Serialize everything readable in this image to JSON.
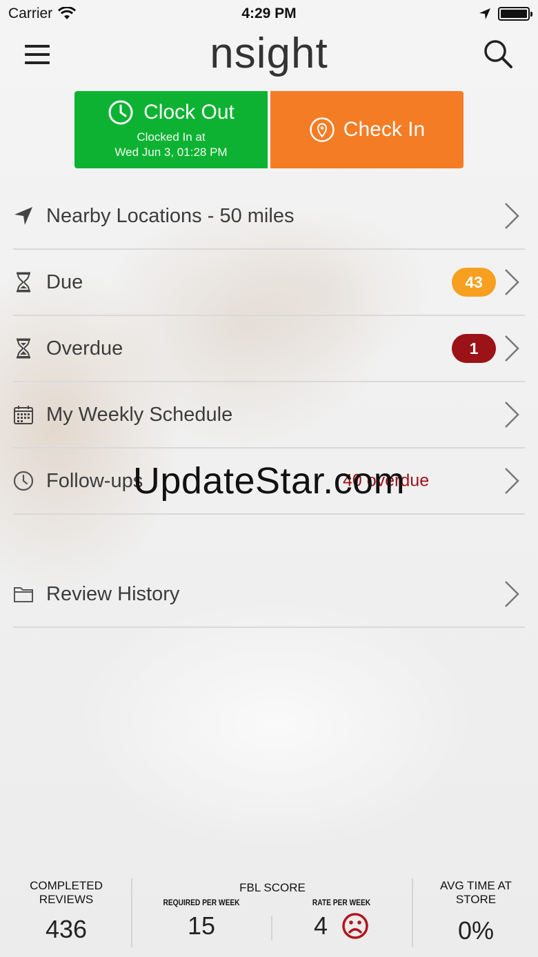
{
  "status_bar": {
    "carrier": "Carrier",
    "time": "4:29 PM"
  },
  "nav": {
    "brand": "nsight"
  },
  "actions": {
    "clock_out": {
      "label": "Clock Out",
      "sub_line1": "Clocked In at",
      "sub_line2": "Wed Jun 3, 01:28 PM",
      "color": "#0db232"
    },
    "check_in": {
      "label": "Check In",
      "color": "#f47c24"
    }
  },
  "menu": {
    "nearby": {
      "label": "Nearby Locations - 50 miles"
    },
    "due": {
      "label": "Due",
      "badge": "43",
      "badge_color": "#f7a01f"
    },
    "overdue": {
      "label": "Overdue",
      "badge": "1",
      "badge_color": "#9b1217"
    },
    "schedule": {
      "label": "My Weekly Schedule"
    },
    "followups": {
      "label": "Follow-ups",
      "status": "40 overdue"
    },
    "history": {
      "label": "Review History"
    }
  },
  "watermark": "UpdateStar.com",
  "footer": {
    "completed": {
      "title_line1": "COMPLETED",
      "title_line2": "REVIEWS",
      "value": "436"
    },
    "fbl": {
      "title": "FBL SCORE",
      "required_label": "REQUIRED PER WEEK",
      "required_value": "15",
      "rate_label": "RATE PER WEEK",
      "rate_value": "4"
    },
    "avg_time": {
      "title_line1": "AVG TIME AT",
      "title_line2": "STORE",
      "value": "0%"
    }
  }
}
